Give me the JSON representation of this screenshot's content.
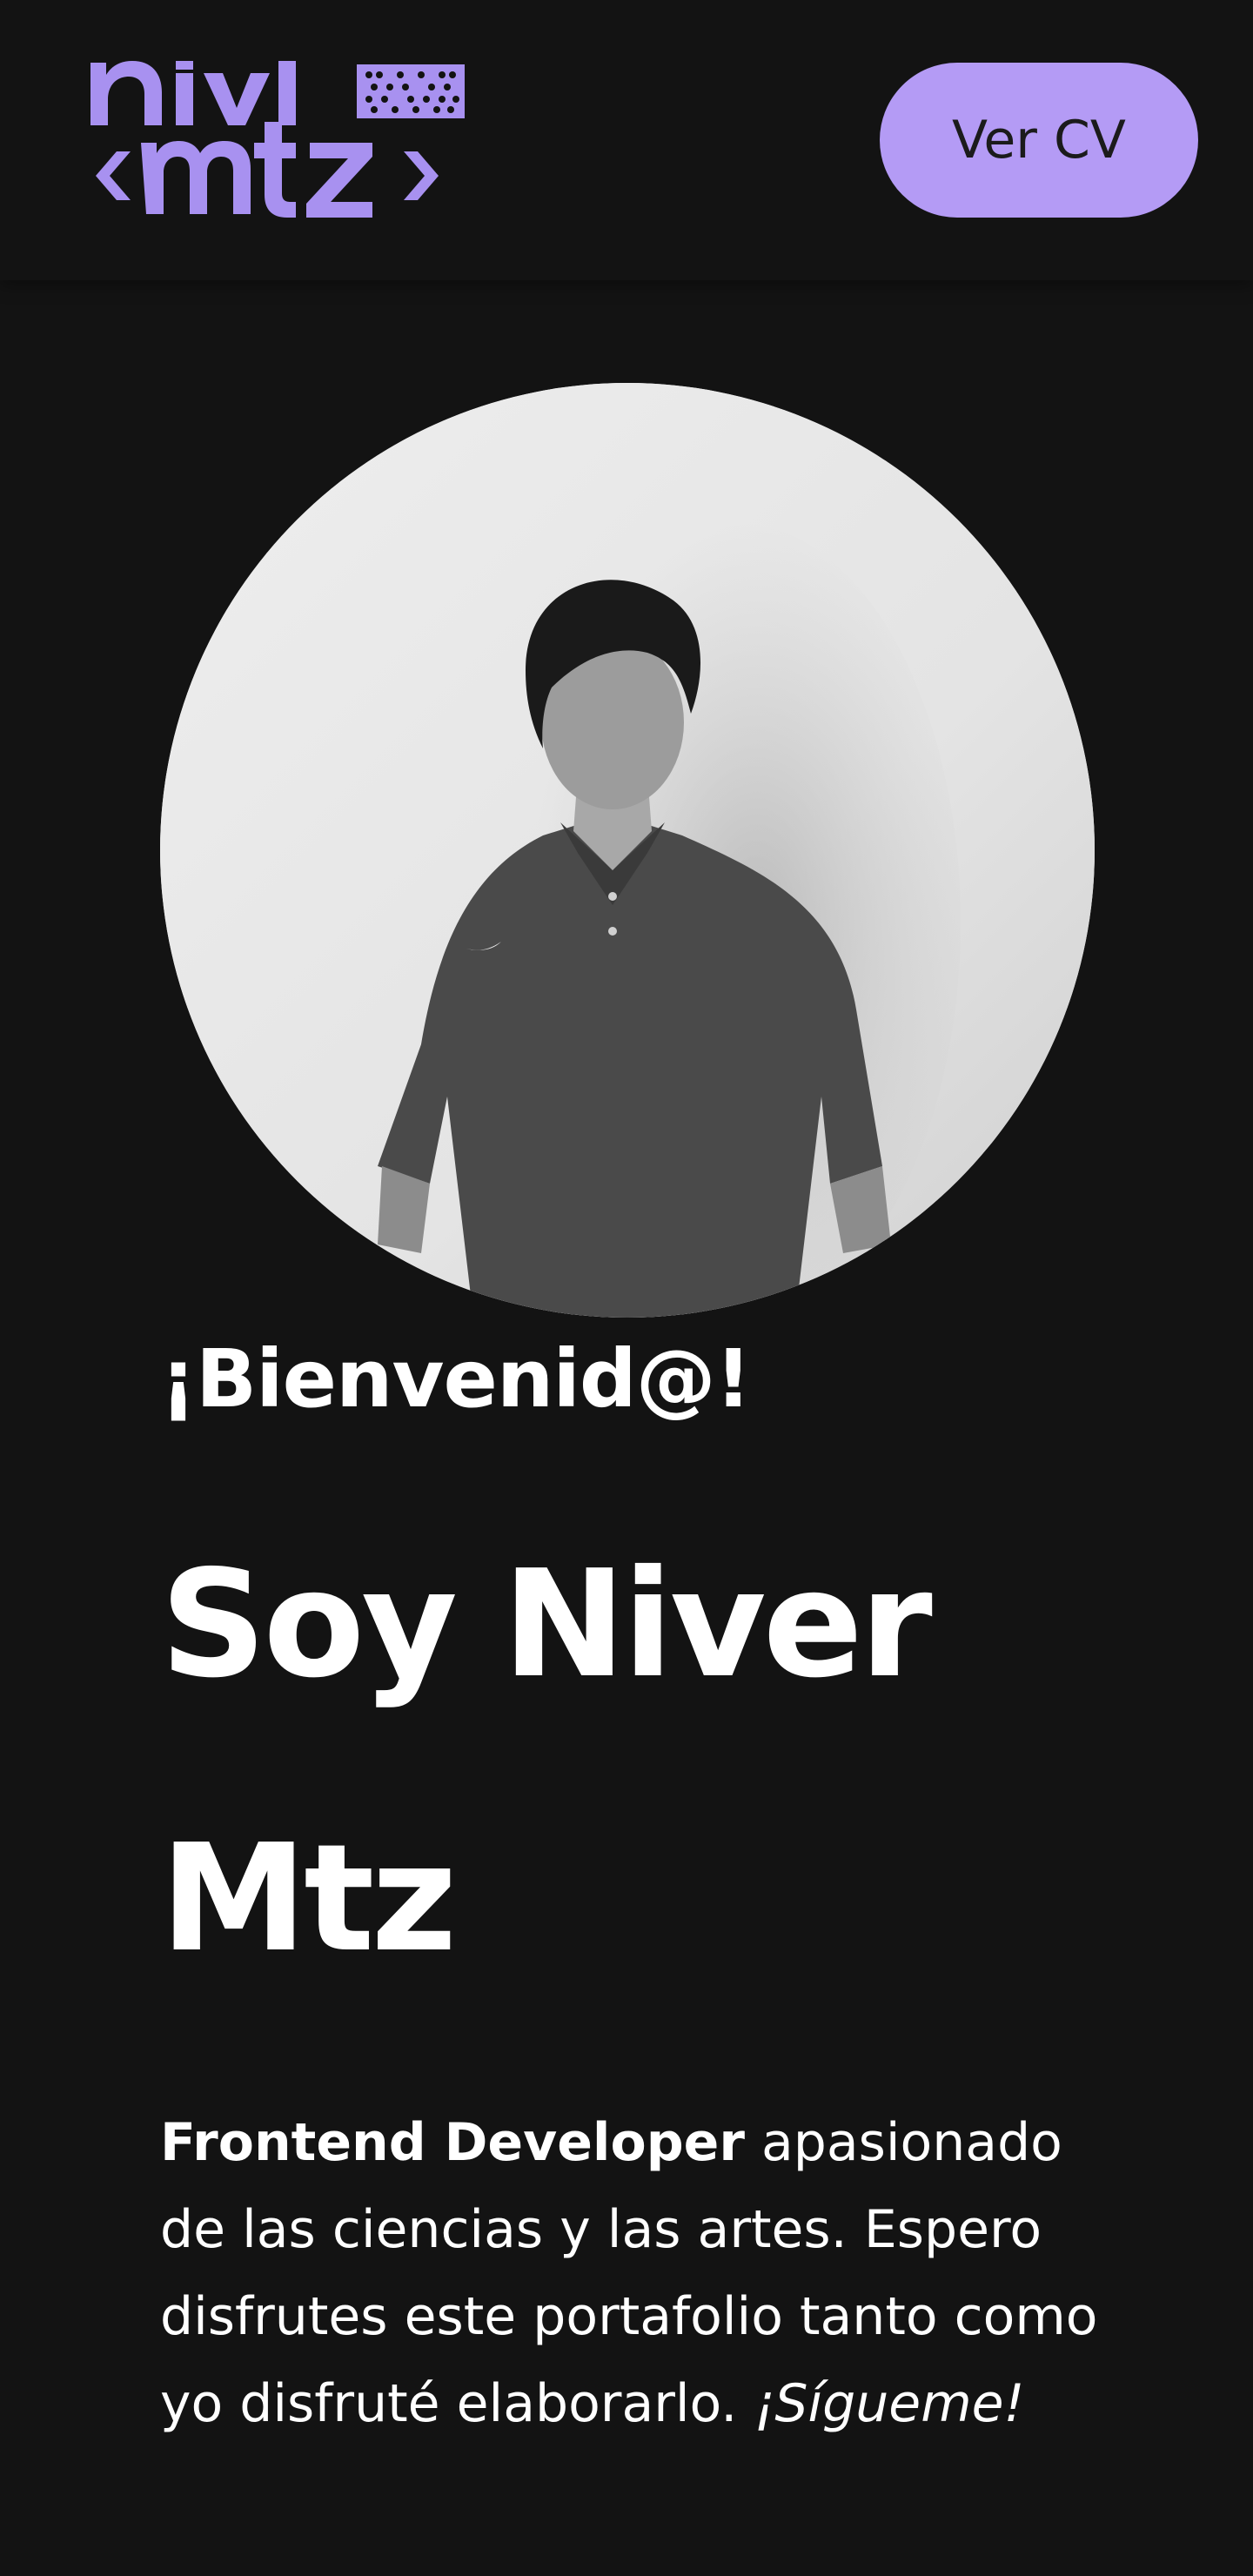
{
  "header": {
    "logo": {
      "top_line": "nivl",
      "bottom_line": "mtz",
      "icon": "niver-mtz-logo-icon"
    },
    "cv_button_label": "Ver CV"
  },
  "colors": {
    "background": "#131313",
    "accent": "#b49bf5",
    "text": "#ffffff"
  },
  "hero": {
    "welcome": "¡Bienvenid@!",
    "name": "Soy Niver Mtz",
    "intro": {
      "highlight": "Frontend Developer",
      "body": " apasionado de las ciencias y las artes. Espero disfrutes este portafolio tanto como yo disfruté elaborarlo. ",
      "call_to_action": "¡Sígueme!"
    }
  }
}
